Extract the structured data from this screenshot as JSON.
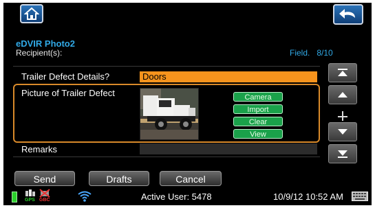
{
  "header": {
    "form_title": "eDVIR Photo2",
    "recipients_label": "Recipient(s):",
    "field_label": "Field.",
    "field_position": "8/10"
  },
  "fields": {
    "defect_details_label": "Trailer Defect Details?",
    "defect_details_value": "Doors",
    "picture_label": "Picture of Trailer Defect",
    "remarks_label": "Remarks"
  },
  "photo_actions": [
    "Camera",
    "Import",
    "Clear",
    "View"
  ],
  "bottom_buttons": {
    "send": "Send",
    "drafts": "Drafts",
    "cancel": "Cancel"
  },
  "status_bar": {
    "gps_label": "GPS",
    "gbc_label": "GBC",
    "active_user": "Active User: 5478",
    "datetime": "10/9/12 10:52 AM"
  },
  "colors": {
    "accent_blue": "#31a9e6",
    "defect_highlight": "#f7941d",
    "action_green": "#1aa14a",
    "panel_border": "#d98a2a"
  },
  "icons": [
    "home-icon",
    "back-arrow-icon",
    "scroll-top-icon",
    "scroll-up-icon",
    "scroll-down-icon",
    "scroll-bottom-icon",
    "battery-icon",
    "gps-icon",
    "gbc-disabled-icon",
    "wifi-icon",
    "keyboard-icon"
  ]
}
